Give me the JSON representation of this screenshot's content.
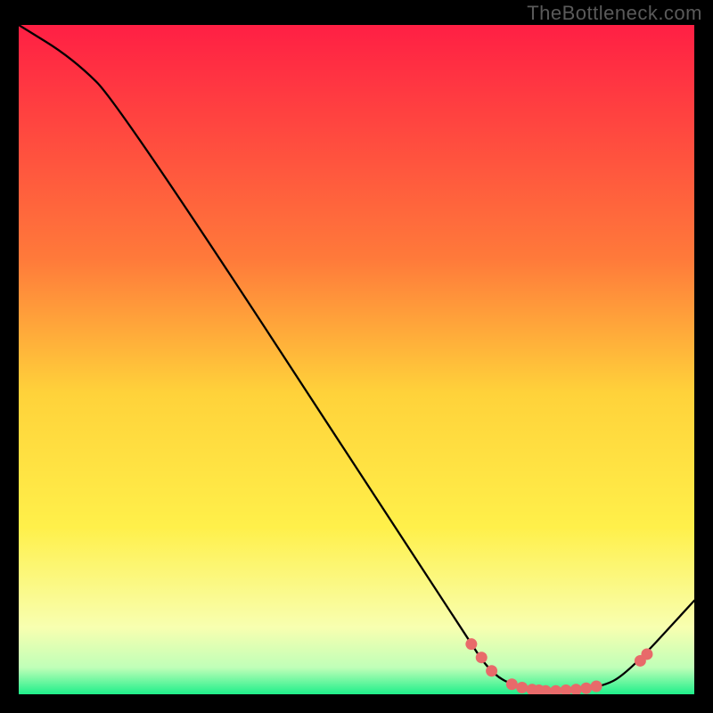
{
  "watermark": "TheBottleneck.com",
  "chart_data": {
    "type": "line",
    "title": "",
    "xlabel": "",
    "ylabel": "",
    "xlim": [
      0,
      100
    ],
    "ylim": [
      0,
      100
    ],
    "gradient": {
      "stops": [
        {
          "offset": 0,
          "color": "#ff1f44"
        },
        {
          "offset": 0.35,
          "color": "#ff7a3a"
        },
        {
          "offset": 0.55,
          "color": "#ffd23a"
        },
        {
          "offset": 0.75,
          "color": "#fff04a"
        },
        {
          "offset": 0.9,
          "color": "#f8ffb0"
        },
        {
          "offset": 0.96,
          "color": "#c0ffb8"
        },
        {
          "offset": 1.0,
          "color": "#1fef8a"
        }
      ]
    },
    "series": [
      {
        "name": "curve",
        "color": "#000000",
        "style": "line",
        "points": [
          {
            "x": 0,
            "y": 100
          },
          {
            "x": 8,
            "y": 95
          },
          {
            "x": 15,
            "y": 88
          },
          {
            "x": 66,
            "y": 9
          },
          {
            "x": 70,
            "y": 3
          },
          {
            "x": 74,
            "y": 1
          },
          {
            "x": 80,
            "y": 0.5
          },
          {
            "x": 86,
            "y": 1
          },
          {
            "x": 90,
            "y": 3
          },
          {
            "x": 100,
            "y": 14
          }
        ]
      },
      {
        "name": "markers",
        "color": "#e86a6a",
        "style": "dots",
        "points": [
          {
            "x": 67,
            "y": 7.5
          },
          {
            "x": 68.5,
            "y": 5.5
          },
          {
            "x": 70,
            "y": 3.5
          },
          {
            "x": 73,
            "y": 1.5
          },
          {
            "x": 74.5,
            "y": 1
          },
          {
            "x": 76,
            "y": 0.7
          },
          {
            "x": 77,
            "y": 0.6
          },
          {
            "x": 78,
            "y": 0.5
          },
          {
            "x": 79.5,
            "y": 0.5
          },
          {
            "x": 81,
            "y": 0.6
          },
          {
            "x": 82.5,
            "y": 0.7
          },
          {
            "x": 84,
            "y": 0.9
          },
          {
            "x": 85.5,
            "y": 1.2
          },
          {
            "x": 92,
            "y": 5
          },
          {
            "x": 93,
            "y": 6
          }
        ]
      }
    ]
  }
}
